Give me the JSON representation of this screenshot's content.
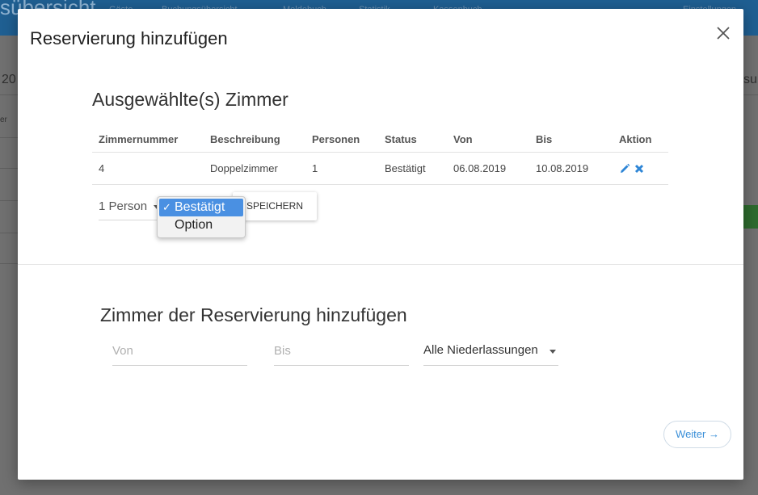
{
  "background": {
    "brand_fragment": "sübersicht",
    "nav": [
      "Gäste",
      "Buchungsübersicht",
      "Meldebuch",
      "Statistik",
      "Kassenbuch"
    ],
    "settings_fragment": "Einstellungen",
    "left_text_1": "20",
    "left_text_2": "er",
    "right_text": "su"
  },
  "modal": {
    "title": "Reservierung hinzufügen",
    "selected_section": {
      "title": "Ausgewählte(s) Zimmer",
      "columns": [
        "Zimmernummer",
        "Beschreibung",
        "Personen",
        "Status",
        "Von",
        "Bis",
        "Aktion"
      ],
      "rows": [
        {
          "number": "4",
          "description": "Doppelzimmer",
          "persons": "1",
          "status": "Bestätigt",
          "from": "06.08.2019",
          "to": "10.08.2019"
        }
      ],
      "persons_select": "1 Person",
      "status_dropdown": {
        "options": [
          "Bestätigt",
          "Option"
        ],
        "checkmark": "✓"
      },
      "save_label": "SPEICHERN"
    },
    "add_section": {
      "title": "Zimmer der Reservierung hinzufügen",
      "from_placeholder": "Von",
      "to_placeholder": "Bis",
      "branch_select": "Alle Niederlassungen"
    },
    "next_label": "Weiter →"
  },
  "colors": {
    "accent": "#3a8fd8",
    "selected_option": "#4a90e2",
    "topbar": "#1f5f92"
  }
}
